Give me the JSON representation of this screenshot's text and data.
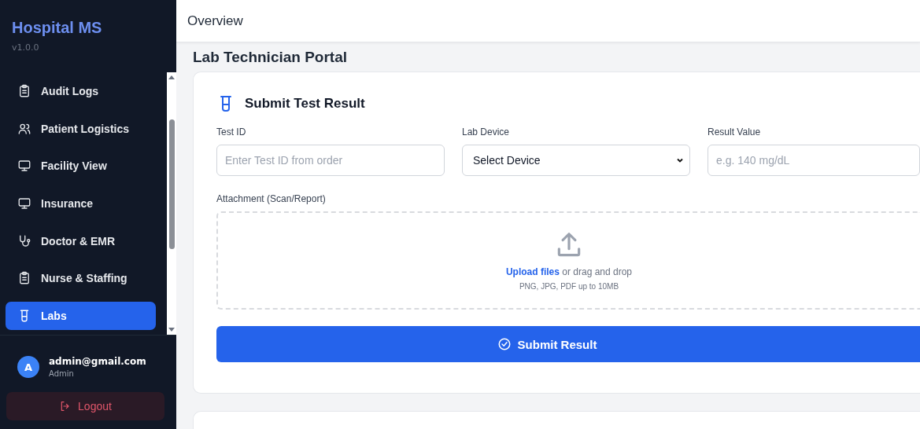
{
  "sidebar": {
    "brand": "Hospital MS",
    "version": "v1.0.0",
    "items": [
      {
        "label": "Audit Logs",
        "selected": false
      },
      {
        "label": "Patient Logistics",
        "selected": false
      },
      {
        "label": "Facility View",
        "selected": false
      },
      {
        "label": "Insurance",
        "selected": false
      },
      {
        "label": "Doctor & EMR",
        "selected": false
      },
      {
        "label": "Nurse & Staffing",
        "selected": false
      },
      {
        "label": "Labs",
        "selected": true
      }
    ],
    "user": {
      "avatar": "A",
      "email": "admin@gmail.com",
      "role": "Admin"
    },
    "logout": "Logout"
  },
  "header": {
    "title": "Overview"
  },
  "page_title": "Lab Technician Portal",
  "form": {
    "title": "Submit Test Result",
    "fields": [
      {
        "kind": "input",
        "label": "Test ID",
        "placeholder": "Enter Test ID from order"
      },
      {
        "kind": "select",
        "label": "Lab Device",
        "value": "Select Device"
      },
      {
        "kind": "input",
        "label": "Result Value",
        "placeholder": "e.g. 140 mg/dL"
      }
    ],
    "attachment": {
      "label": "Attachment (Scan/Report)",
      "link": "Upload files",
      "text": " or drag and drop",
      "hint": "PNG, JPG, PDF up to 10MB"
    },
    "submit": "Submit Result"
  }
}
